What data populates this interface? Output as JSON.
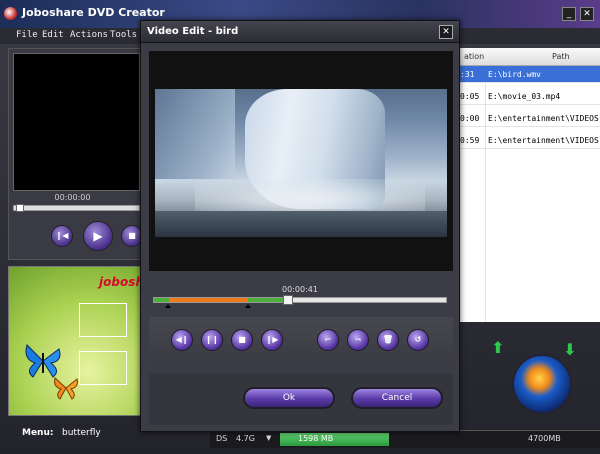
{
  "app": {
    "title": "Joboshare DVD Creator",
    "minimize": "_",
    "close": "✕",
    "menu": [
      "File",
      "Edit",
      "Actions",
      "Tools"
    ]
  },
  "preview": {
    "time": "00:00:00",
    "controls": [
      "prev",
      "play",
      "stop"
    ]
  },
  "menu_panel": {
    "brand": "joboshare",
    "label": "Menu:",
    "value": "butterfly"
  },
  "file_list": {
    "col_duration": "ation",
    "col_path": "Path",
    "rows": [
      {
        "duration": ":31",
        "path": "E:\\bird.wmv",
        "selected": true
      },
      {
        "duration": "0:05",
        "path": "E:\\movie_03.mp4",
        "selected": false
      },
      {
        "duration": "0:00",
        "path": "E:\\entertainment\\VIDEOS",
        "selected": false
      },
      {
        "duration": "0:59",
        "path": "E:\\entertainment\\VIDEOS",
        "selected": false
      }
    ]
  },
  "status": {
    "ds": "DS",
    "capacity": "4.7G",
    "used": "1598 MB",
    "total": "4700MB",
    "used_fraction": 0.34
  },
  "dialog": {
    "title": "Video Edit - bird",
    "close": "✕",
    "time": "00:00:41",
    "ok": "Ok",
    "cancel": "Cancel",
    "timeline": {
      "played_fraction": 0.46,
      "selection_start": 0.05,
      "selection_end": 0.32
    }
  },
  "colors": {
    "selected_row": "#3a6fd8",
    "button_purple": "#5a36a6",
    "progress_green": "#4caf3a",
    "selection_orange": "#ef7a1a"
  }
}
